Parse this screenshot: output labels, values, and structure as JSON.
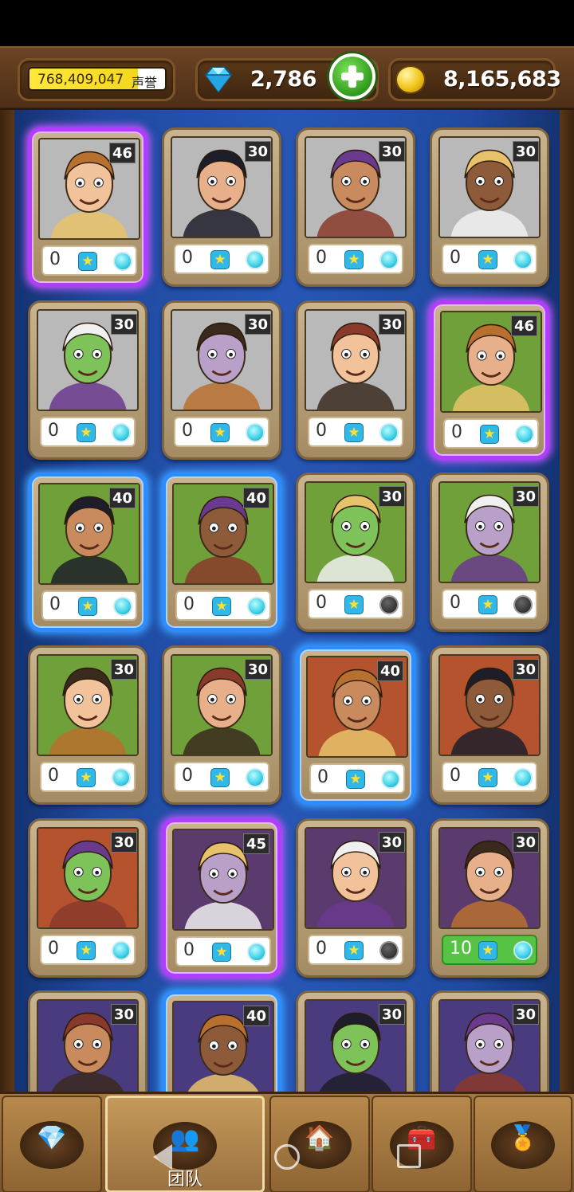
{
  "header": {
    "reputation_value": "768,409,047",
    "reputation_label": "声誉",
    "gems": "2,786",
    "gold": "8,165,683",
    "icons": {
      "gem": "diamond-icon",
      "add": "plus-icon",
      "gold": "gold-coin-icon"
    }
  },
  "cards": [
    {
      "level": "46",
      "stars": "0",
      "frame": "purple",
      "bg": "#b9b9b9",
      "gem_active": true,
      "character": "bearded-lumberjack"
    },
    {
      "level": "30",
      "stars": "0",
      "frame": "plain",
      "bg": "#b9b9b9",
      "gem_active": true,
      "character": "curly-haired-writer"
    },
    {
      "level": "30",
      "stars": "0",
      "frame": "plain",
      "bg": "#b9b9b9",
      "gem_active": true,
      "character": "dreamy-boy-with-flower"
    },
    {
      "level": "30",
      "stars": "0",
      "frame": "plain",
      "bg": "#b9b9b9",
      "gem_active": true,
      "character": "cats"
    },
    {
      "level": "30",
      "stars": "0",
      "frame": "plain",
      "bg": "#b9b9b9",
      "gem_active": true,
      "character": "man-with-turban"
    },
    {
      "level": "30",
      "stars": "0",
      "frame": "plain",
      "bg": "#b9b9b9",
      "gem_active": true,
      "character": "vampire-girl"
    },
    {
      "level": "30",
      "stars": "0",
      "frame": "plain",
      "bg": "#b9b9b9",
      "gem_active": true,
      "character": "penguins"
    },
    {
      "level": "46",
      "stars": "0",
      "frame": "purple",
      "bg": "#6fa03a",
      "gem_active": true,
      "character": "santa-claus"
    },
    {
      "level": "40",
      "stars": "0",
      "frame": "blue",
      "bg": "#6fa03a",
      "gem_active": true,
      "character": "old-wizard"
    },
    {
      "level": "40",
      "stars": "0",
      "frame": "blue",
      "bg": "#6fa03a",
      "gem_active": true,
      "character": "dark-haired-woman"
    },
    {
      "level": "30",
      "stars": "0",
      "frame": "plain",
      "bg": "#6fa03a",
      "gem_active": false,
      "character": "boy-with-goblet"
    },
    {
      "level": "30",
      "stars": "0",
      "frame": "plain",
      "bg": "#6fa03a",
      "gem_active": false,
      "character": "green-girl"
    },
    {
      "level": "30",
      "stars": "0",
      "frame": "plain",
      "bg": "#6fa03a",
      "gem_active": true,
      "character": "long-haired-man"
    },
    {
      "level": "30",
      "stars": "0",
      "frame": "plain",
      "bg": "#6fa03a",
      "gem_active": true,
      "character": "grinning-man"
    },
    {
      "level": "40",
      "stars": "0",
      "frame": "blue",
      "bg": "#b4532e",
      "gem_active": true,
      "character": "demon-woman-with-whip"
    },
    {
      "level": "30",
      "stars": "0",
      "frame": "plain",
      "bg": "#b4532e",
      "gem_active": true,
      "character": "mustached-gentleman"
    },
    {
      "level": "30",
      "stars": "0",
      "frame": "plain",
      "bg": "#b4532e",
      "gem_active": true,
      "character": "orc-with-glasses"
    },
    {
      "level": "45",
      "stars": "0",
      "frame": "purple",
      "bg": "#5b3a6e",
      "gem_active": true,
      "character": "haggard-woman"
    },
    {
      "level": "30",
      "stars": "0",
      "frame": "plain",
      "bg": "#5b3a6e",
      "gem_active": false,
      "character": "bald-man-with-shovel"
    },
    {
      "level": "30",
      "stars": "10",
      "frame": "plain",
      "bg": "#5b3a6e",
      "gem_active": true,
      "highlight": true,
      "character": "blonde-girl-with-book"
    },
    {
      "level": "30",
      "stars": "",
      "frame": "plain",
      "bg": "#4a3a7e",
      "gem_active": true,
      "character": "hooded-woman"
    },
    {
      "level": "40",
      "stars": "",
      "frame": "blue",
      "bg": "#4a3a7e",
      "gem_active": true,
      "character": "angry-bald-warrior"
    },
    {
      "level": "30",
      "stars": "",
      "frame": "plain",
      "bg": "#4a3a7e",
      "gem_active": true,
      "character": "woman-with-scarf"
    },
    {
      "level": "30",
      "stars": "",
      "frame": "plain",
      "bg": "#4a3a7e",
      "gem_active": true,
      "character": "woman-with-headwrap"
    }
  ],
  "bottom_nav": {
    "tabs": [
      {
        "icon": "gems-icon",
        "glyph": "💎",
        "label": ""
      },
      {
        "icon": "team-icon",
        "glyph": "👥",
        "label": "团队",
        "active": true
      },
      {
        "icon": "house-icon",
        "glyph": "🏠",
        "label": ""
      },
      {
        "icon": "treasure-chest-icon",
        "glyph": "🧰",
        "label": ""
      },
      {
        "icon": "medal-icon",
        "glyph": "🏅",
        "label": ""
      }
    ]
  }
}
